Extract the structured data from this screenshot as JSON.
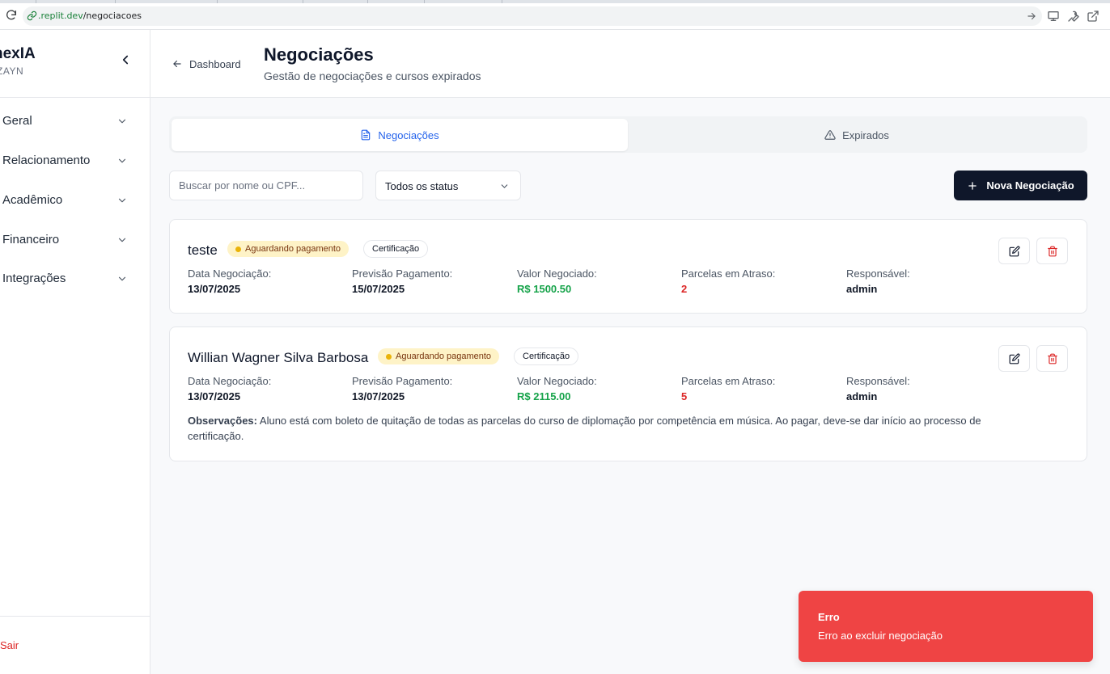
{
  "browser": {
    "url_host": ".replit.dev",
    "url_path": "/negociacoes"
  },
  "sidebar": {
    "brand": "nexIA",
    "brand_sub": "ZAYN",
    "items": [
      {
        "label": "Geral"
      },
      {
        "label": "Relacionamento"
      },
      {
        "label": "Acadêmico"
      },
      {
        "label": "Financeiro"
      },
      {
        "label": "Integrações"
      }
    ],
    "logout_label": "Sair"
  },
  "header": {
    "back_label": "Dashboard",
    "title": "Negociações",
    "subtitle": "Gestão de negociações e cursos expirados"
  },
  "tabs": [
    {
      "label": "Negociações",
      "icon": "file-text-icon",
      "active": true
    },
    {
      "label": "Expirados",
      "icon": "alert-triangle-icon",
      "active": false
    }
  ],
  "filters": {
    "search_placeholder": "Buscar por nome ou CPF...",
    "search_value": "",
    "status_value": "Todos os status",
    "new_button_label": "Nova Negociação"
  },
  "field_labels": {
    "date": "Data Negociação:",
    "forecast": "Previsão Pagamento:",
    "amount": "Valor Negociado:",
    "overdue": "Parcelas em Atraso:",
    "owner": "Responsável:",
    "notes": "Observações:"
  },
  "negotiations": [
    {
      "name": "teste",
      "status": "Aguardando pagamento",
      "type": "Certificação",
      "date": "13/07/2025",
      "forecast": "15/07/2025",
      "amount": "R$ 1500.50",
      "overdue": "2",
      "owner": "admin"
    },
    {
      "name": "Willian Wagner Silva Barbosa",
      "status": "Aguardando pagamento",
      "type": "Certificação",
      "date": "13/07/2025",
      "forecast": "13/07/2025",
      "amount": "R$ 2115.00",
      "overdue": "5",
      "owner": "admin",
      "notes": "Aluno está com boleto de quitação de todas as parcelas do curso de diplomação por competência em música. Ao pagar, deve-se dar início ao processo de certificação."
    }
  ],
  "toast": {
    "title": "Erro",
    "message": "Erro ao excluir negociação"
  },
  "colors": {
    "primary_button": "#0f172a",
    "accent_blue": "#2563eb",
    "money_green": "#16a34a",
    "danger_red": "#dc2626",
    "status_badge_bg": "#fef3c7",
    "toast_bg": "#ef4444"
  }
}
